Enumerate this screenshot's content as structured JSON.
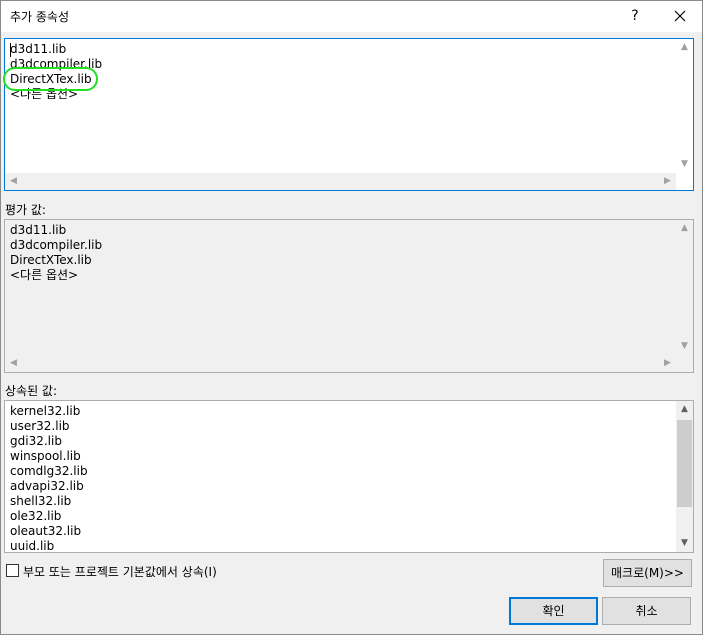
{
  "dialog": {
    "title": "추가 종속성",
    "help_label": "?"
  },
  "edit_box": {
    "lines": [
      "d3d11.lib",
      "d3dcompiler.lib",
      "DirectXTex.lib",
      "<다른 옵션>"
    ]
  },
  "evaluated": {
    "label": "평가 값:",
    "lines": [
      "d3d11.lib",
      "d3dcompiler.lib",
      "DirectXTex.lib",
      "<다른 옵션>"
    ]
  },
  "inherited": {
    "label": "상속된 값:",
    "lines": [
      "kernel32.lib",
      "user32.lib",
      "gdi32.lib",
      "winspool.lib",
      "comdlg32.lib",
      "advapi32.lib",
      "shell32.lib",
      "ole32.lib",
      "oleaut32.lib",
      "uuid.lib"
    ]
  },
  "inherit_checkbox": {
    "label": "부모 또는 프로젝트 기본값에서 상속(I)",
    "checked": false
  },
  "buttons": {
    "macro": "매크로(M)>>",
    "ok": "확인",
    "cancel": "취소"
  },
  "colors": {
    "highlight": "#22e022",
    "focus": "#0078d7"
  }
}
